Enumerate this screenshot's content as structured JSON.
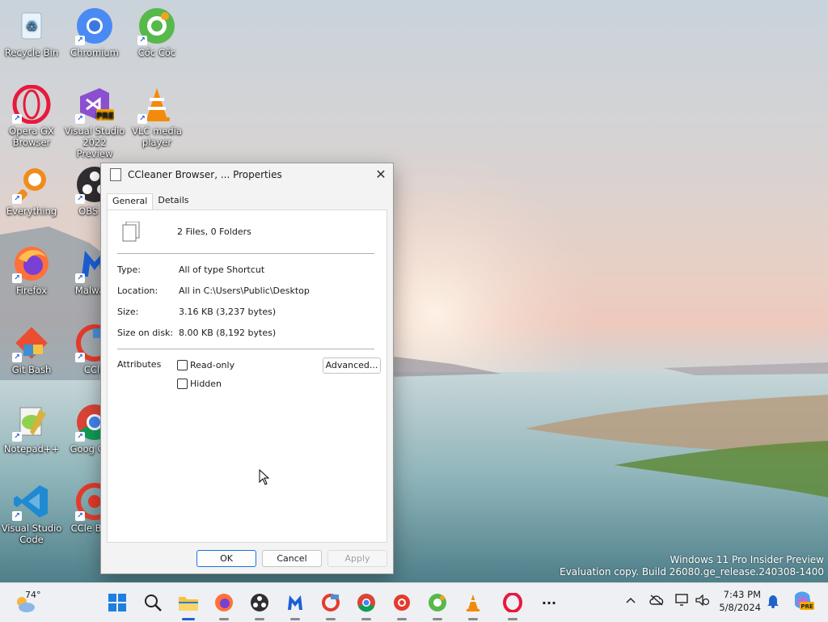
{
  "desktop": {
    "icons": [
      {
        "label": "Recycle Bin"
      },
      {
        "label": "Chromium"
      },
      {
        "label": "Cốc Cốc"
      },
      {
        "label": "Opera GX Browser"
      },
      {
        "label": "Visual Studio 2022 Preview"
      },
      {
        "label": "VLC media player"
      },
      {
        "label": "Everything"
      },
      {
        "label": "OBS St"
      },
      {
        "label": "Firefox"
      },
      {
        "label": "Malware"
      },
      {
        "label": "Git Bash"
      },
      {
        "label": "CCle"
      },
      {
        "label": "Notepad++"
      },
      {
        "label": "Goog Chro"
      },
      {
        "label": "Visual Studio Code"
      },
      {
        "label": "CCle Brow"
      }
    ],
    "vs_badge": "PRE"
  },
  "dialog": {
    "title": "CCleaner Browser, ... Properties",
    "close_glyph": "✕",
    "tabs": [
      {
        "label": "General",
        "active": true
      },
      {
        "label": "Details",
        "active": false
      }
    ],
    "summary": "2 Files, 0 Folders",
    "fields": [
      {
        "label": "Type:",
        "value": "All of type Shortcut"
      },
      {
        "label": "Location:",
        "value": "All in C:\\Users\\Public\\Desktop"
      },
      {
        "label": "Size:",
        "value": "3.16 KB (3,237 bytes)"
      },
      {
        "label": "Size on disk:",
        "value": "8.00 KB (8,192 bytes)"
      }
    ],
    "attributes_label": "Attributes",
    "checkboxes": [
      {
        "label": "Read-only",
        "checked": false
      },
      {
        "label": "Hidden",
        "checked": false
      }
    ],
    "advanced_label": "Advanced...",
    "buttons": {
      "ok": "OK",
      "cancel": "Cancel",
      "apply": "Apply"
    }
  },
  "watermark": {
    "line1": "Windows 11 Pro Insider Preview",
    "line2": "Evaluation copy. Build 26080.ge_release.240308-1400"
  },
  "taskbar": {
    "weather": "74°",
    "apps": [
      "start",
      "search",
      "file-explorer",
      "firefox",
      "obs",
      "malwarebytes",
      "ccleaner",
      "chrome",
      "ccleaner-browser",
      "coccoc",
      "vlc",
      "opera",
      "more"
    ],
    "more_glyph": "···",
    "chevron": "^",
    "time": "7:43 PM",
    "date": "5/8/2024",
    "copilot_badge": "PRE"
  },
  "colors": {
    "accent": "#1e63c9",
    "taskbar": "#eef0f3",
    "dialog_bg": "#f3f3f3"
  }
}
